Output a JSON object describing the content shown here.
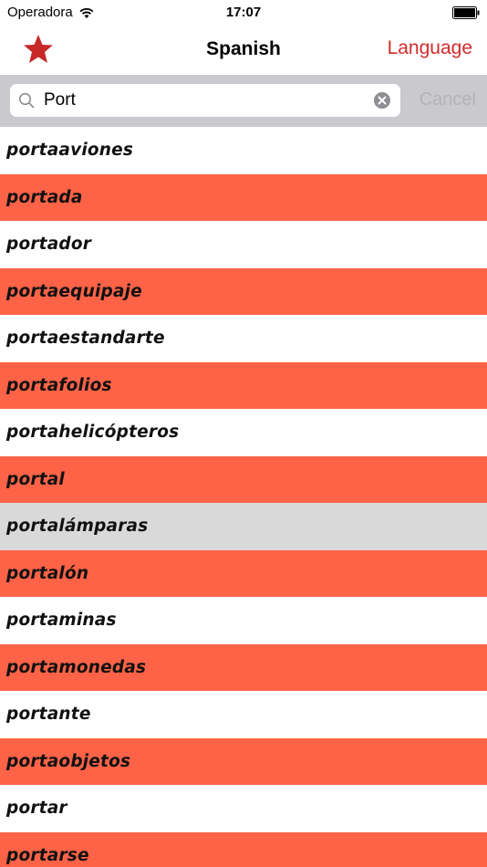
{
  "status_bar": {
    "carrier": "Operadora",
    "time": "17:07"
  },
  "nav": {
    "title": "Spanish",
    "language_label": "Language",
    "favorites_icon": "star-icon"
  },
  "search": {
    "query": "Port",
    "cancel_label": "Cancel"
  },
  "colors": {
    "accent": "#d22b2b",
    "row_alt": "#ff6347",
    "row_selected": "#d9d9d9",
    "search_bar_bg": "#c9c9ce"
  },
  "words": [
    {
      "text": "portaaviones",
      "style": "plain"
    },
    {
      "text": "portada",
      "style": "alt"
    },
    {
      "text": "portador",
      "style": "plain"
    },
    {
      "text": "portaequipaje",
      "style": "alt"
    },
    {
      "text": "portaestandarte",
      "style": "plain"
    },
    {
      "text": "portafolios",
      "style": "alt"
    },
    {
      "text": "portahelicópteros",
      "style": "plain"
    },
    {
      "text": "portal",
      "style": "alt"
    },
    {
      "text": "portalámparas",
      "style": "selected"
    },
    {
      "text": "portalón",
      "style": "alt"
    },
    {
      "text": "portaminas",
      "style": "plain"
    },
    {
      "text": "portamonedas",
      "style": "alt"
    },
    {
      "text": "portante",
      "style": "plain"
    },
    {
      "text": "portaobjetos",
      "style": "alt"
    },
    {
      "text": "portar",
      "style": "plain"
    },
    {
      "text": "portarse",
      "style": "alt"
    }
  ]
}
